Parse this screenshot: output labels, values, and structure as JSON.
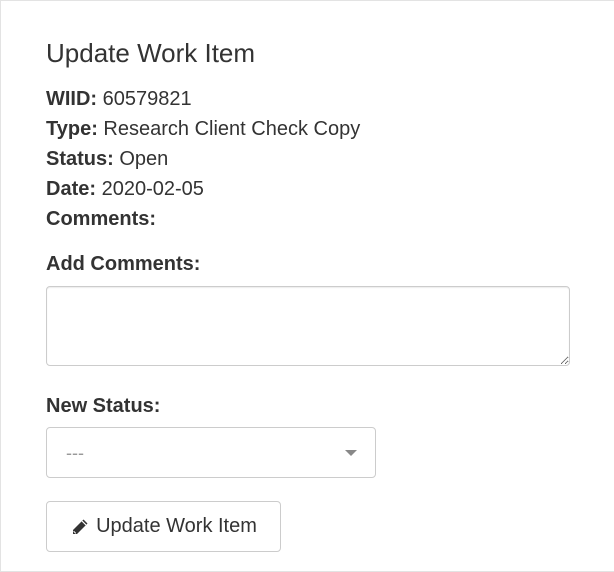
{
  "title": "Update Work Item",
  "details": {
    "wiid": {
      "label": "WIID:",
      "value": "60579821"
    },
    "type": {
      "label": "Type:",
      "value": "Research Client Check Copy"
    },
    "status": {
      "label": "Status:",
      "value": "Open"
    },
    "date": {
      "label": "Date:",
      "value": "2020-02-05"
    },
    "comments": {
      "label": "Comments:",
      "value": ""
    }
  },
  "form": {
    "add_comments_label": "Add Comments:",
    "add_comments_value": "",
    "new_status_label": "New Status:",
    "new_status_selected": "---"
  },
  "submit": {
    "label": "Update Work Item",
    "icon": "pencil-icon"
  }
}
